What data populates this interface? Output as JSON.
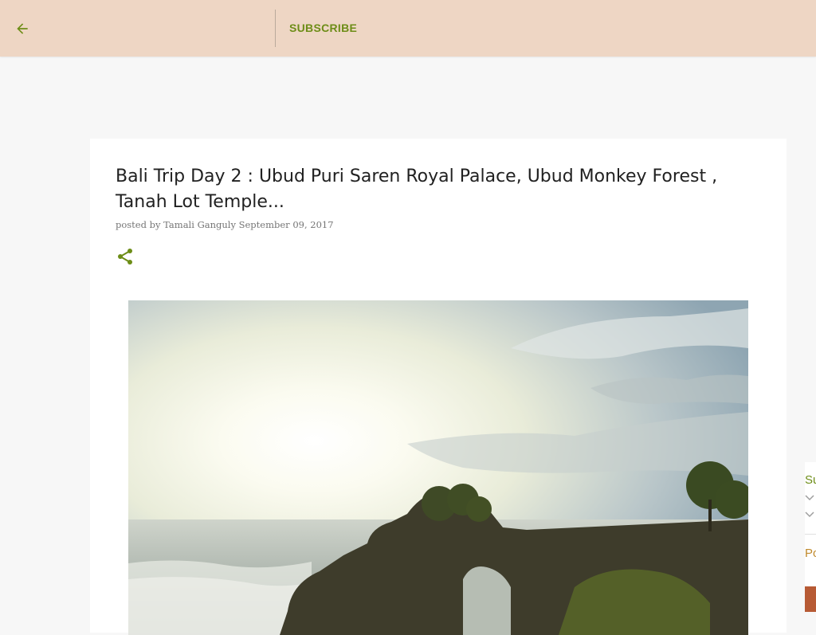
{
  "header": {
    "subscribe_label": "SUBSCRIBE",
    "back_icon": "arrow-left-icon",
    "accent_color": "#6d8d17",
    "bar_color": "#eed6c4"
  },
  "post": {
    "title": "Bali Trip Day 2 : Ubud Puri Saren Royal Palace, Ubud Monkey Forest , Tanah Lot Temple...",
    "byline_prefix": "posted by",
    "author": "Tamali Ganguly",
    "date": "September 09, 2017",
    "share_icon": "share-icon"
  },
  "sidebar_peek": {
    "widget1_label": "Su",
    "widget2_label": "Po"
  }
}
